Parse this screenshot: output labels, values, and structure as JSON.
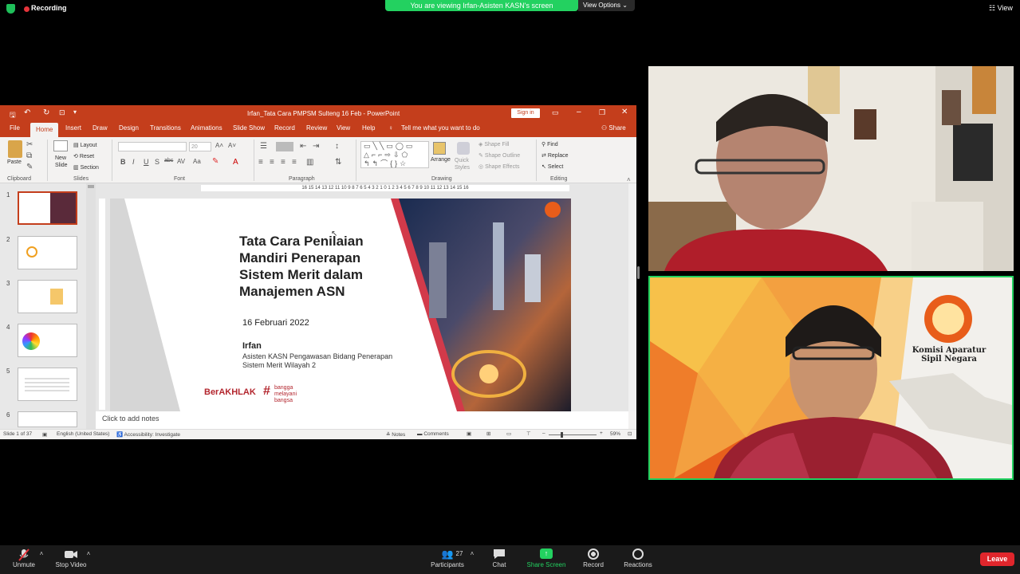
{
  "topbar": {
    "recording": "Recording",
    "viewing_banner": "You are viewing Irfan-Asisten KASN's screen",
    "view_options": "View Options",
    "view": "View"
  },
  "ppt": {
    "title": "Irfan_Tata Cara PMPSM Sulteng 16 Feb  -  PowerPoint",
    "sign_in": "Sign in",
    "tabs": [
      "File",
      "Home",
      "Insert",
      "Draw",
      "Design",
      "Transitions",
      "Animations",
      "Slide Show",
      "Record",
      "Review",
      "View",
      "Help"
    ],
    "tell_me": "Tell me what you want to do",
    "share": "Share",
    "ribbon": {
      "paste": "Paste",
      "new_slide": "New Slide",
      "layout": "Layout",
      "reset": "Reset",
      "section": "Section",
      "font_size": "20",
      "arrange": "Arrange",
      "quick_styles": "Quick Styles",
      "shape_fill": "Shape Fill",
      "shape_outline": "Shape Outline",
      "shape_effects": "Shape Effects",
      "find": "Find",
      "replace": "Replace",
      "select": "Select",
      "groups": [
        "Clipboard",
        "Slides",
        "Font",
        "Paragraph",
        "Drawing",
        "Editing"
      ]
    },
    "thumb_numbers": [
      "1",
      "2",
      "3",
      "4",
      "5",
      "6"
    ],
    "ruler": "16 15 14 13 12 11 10 9 8 7 6 5 4 3 2 1 0 1 2 3 4 5 6 7 8 9 10 11 12 13 14 15 16",
    "slide": {
      "title_lines": [
        "Tata Cara Penilaian",
        "Mandiri Penerapan",
        "Sistem Merit dalam",
        "Manajemen ASN"
      ],
      "date": "16 Februari 2022",
      "name": "Irfan",
      "role_lines": [
        "Asisten KASN Pengawasan Bidang Penerapan",
        "Sistem Merit Wilayah 2"
      ],
      "logo1": "BerAKHLAK",
      "logo2_lines": [
        "bangga",
        "melayani",
        "bangsa"
      ]
    },
    "notes": "Click to add notes",
    "status": {
      "slide": "Slide 1 of 37",
      "language": "English (United States)",
      "accessibility": "Accessibility: Investigate",
      "notes": "Notes",
      "comments": "Comments",
      "zoom": "59%"
    }
  },
  "video2": {
    "org_lines": [
      "Komisi Aparatur",
      "Sipil Negara"
    ]
  },
  "bottombar": {
    "unmute": "Unmute",
    "stop_video": "Stop Video",
    "participants": "Participants",
    "participants_count": "27",
    "chat": "Chat",
    "share_screen": "Share Screen",
    "record": "Record",
    "reactions": "Reactions",
    "leave": "Leave"
  },
  "colors": {
    "ppt_accent": "#c43e1c",
    "zoom_green": "#23d160",
    "leave_red": "#e0262c"
  }
}
